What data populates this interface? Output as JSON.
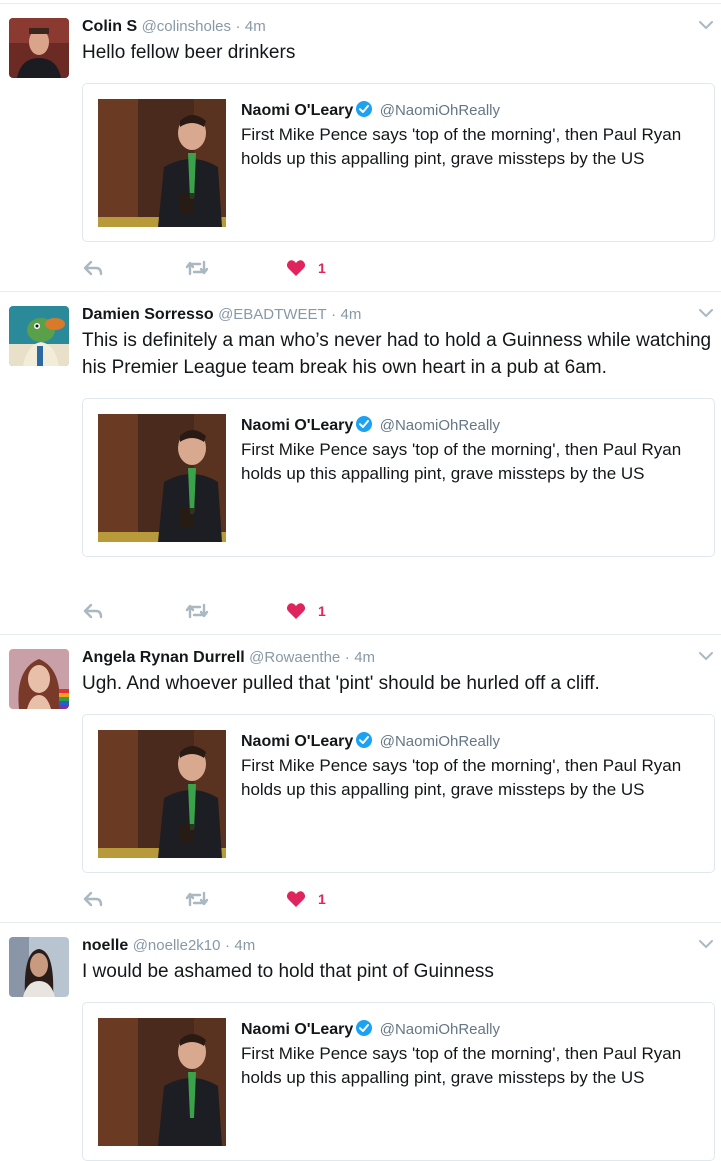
{
  "colors": {
    "like": "#e0245e",
    "verified": "#1da1f2",
    "meta": "#8899a6"
  },
  "quoted": {
    "name": "Naomi O'Leary",
    "handle": "@NaomiOhReally",
    "text": "First Mike Pence says 'top of the morning', then Paul Ryan holds up this appalling pint, grave missteps by the US"
  },
  "tweets": [
    {
      "name": "Colin S",
      "handle": "@colinsholes",
      "dot": "·",
      "time": "4m",
      "text": "Hello fellow beer drinkers",
      "likes": "1"
    },
    {
      "name": "Damien Sorresso",
      "handle": "@EBADTWEET",
      "dot": "·",
      "time": "4m",
      "text": "This is definitely a man who’s never had to hold a Guinness while watching his Premier League team break his own heart in a pub at 6am.",
      "likes": "1"
    },
    {
      "name": "Angela Rynan Durrell",
      "handle": "@Rowaenthe",
      "dot": "·",
      "time": "4m",
      "text": "Ugh. And whoever pulled that 'pint' should be hurled off a cliff.",
      "likes": "1"
    },
    {
      "name": "noelle",
      "handle": "@noelle2k10",
      "dot": "·",
      "time": "4m",
      "text": "I would be ashamed to hold that pint of Guinness"
    }
  ]
}
